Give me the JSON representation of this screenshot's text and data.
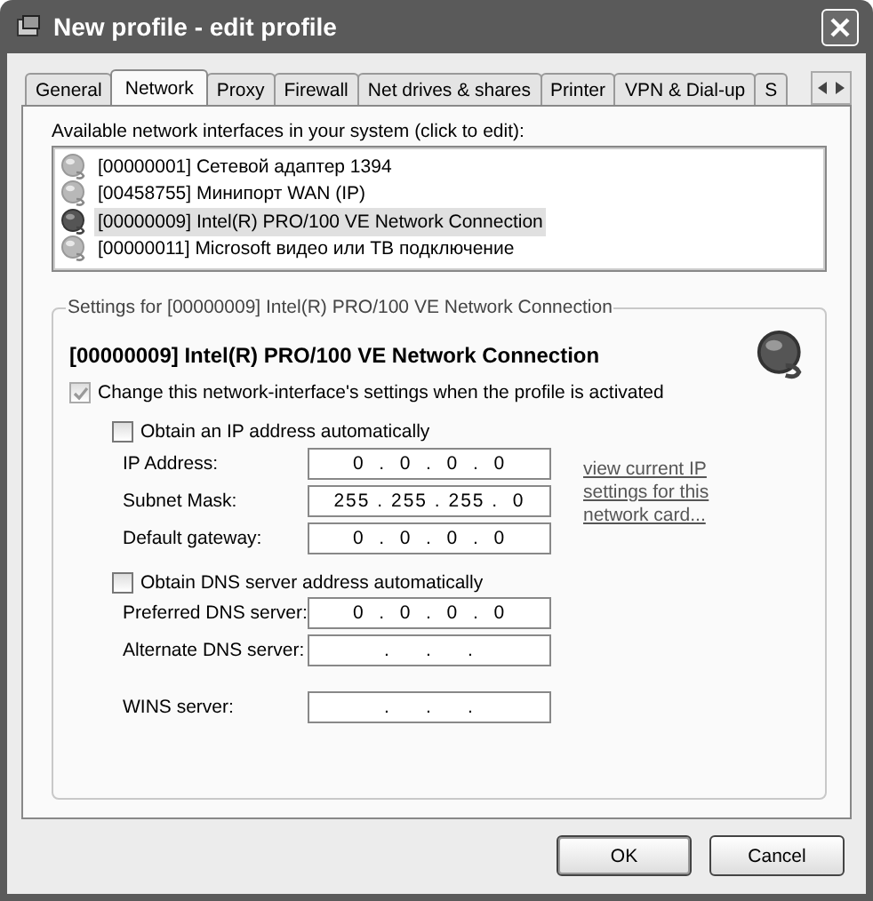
{
  "window": {
    "title": "New profile - edit profile"
  },
  "tabs": [
    {
      "label": "General",
      "selected": false
    },
    {
      "label": "Network",
      "selected": true
    },
    {
      "label": "Proxy",
      "selected": false
    },
    {
      "label": "Firewall",
      "selected": false
    },
    {
      "label": "Net drives & shares",
      "selected": false
    },
    {
      "label": "Printer",
      "selected": false
    },
    {
      "label": "VPN & Dial-up",
      "selected": false
    },
    {
      "label": "S",
      "selected": false
    }
  ],
  "interfaces": {
    "label": "Available network interfaces in your system (click to edit):",
    "items": [
      {
        "label": "[00000001] Сетевой адаптер 1394",
        "selected": false
      },
      {
        "label": "[00458755] Минипорт WAN (IP)",
        "selected": false
      },
      {
        "label": "[00000009] Intel(R) PRO/100 VE Network Connection",
        "selected": true
      },
      {
        "label": "[00000011] Microsoft видео или ТВ подключение",
        "selected": false
      }
    ]
  },
  "settings": {
    "legend": "Settings for [00000009] Intel(R) PRO/100 VE Network Connection",
    "heading": "[00000009] Intel(R) PRO/100 VE Network Connection",
    "change_checkbox": {
      "label": "Change this network-interface's settings when the profile is activated",
      "checked": true,
      "disabled": true
    },
    "ip_auto": {
      "label": "Obtain an IP address automatically",
      "checked": false
    },
    "ip_fields": [
      {
        "label": "IP Address:",
        "value": "0  .  0  .  0  .  0"
      },
      {
        "label": "Subnet Mask:",
        "value": "255 . 255 . 255 .  0"
      },
      {
        "label": "Default gateway:",
        "value": "0  .  0  .  0  .  0"
      }
    ],
    "link": "view current IP settings for this network card...",
    "dns_auto": {
      "label": "Obtain DNS server address automatically",
      "checked": false
    },
    "dns_fields": [
      {
        "label": "Preferred DNS server:",
        "value": "0  .  0  .  0  .  0"
      },
      {
        "label": "Alternate DNS server:",
        "value": ".     .     ."
      }
    ],
    "wins": {
      "label": "WINS server:",
      "value": ".     .     ."
    }
  },
  "buttons": [
    {
      "label": "OK",
      "default": true
    },
    {
      "label": "Cancel",
      "default": false
    }
  ]
}
